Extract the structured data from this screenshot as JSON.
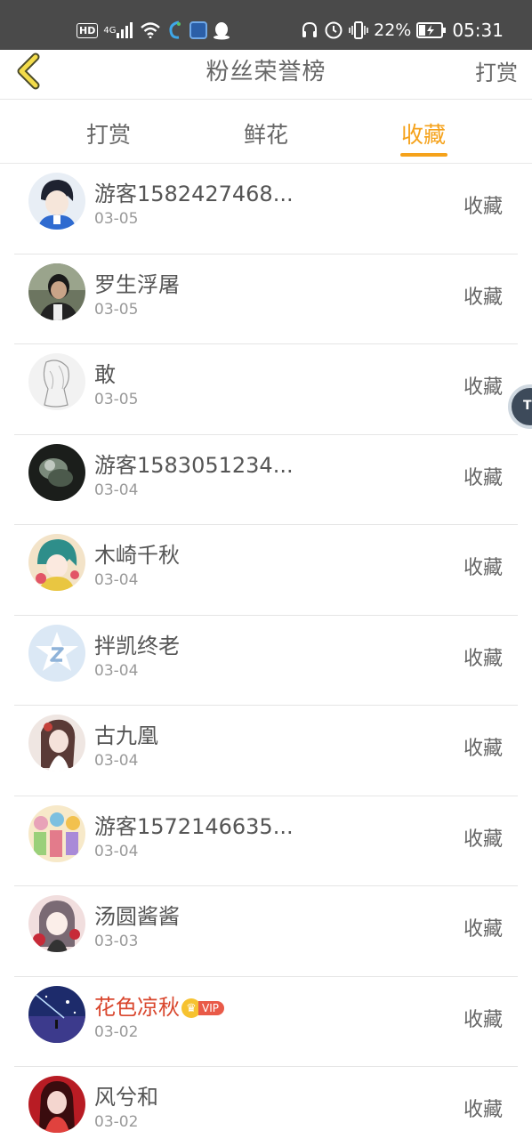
{
  "status_bar": {
    "left_icons": [
      "hd-icon",
      "4g-signal-icon",
      "wifi-icon",
      "phone-app-icon",
      "chat-app-icon",
      "qq-icon"
    ],
    "right_icons": [
      "headset-icon",
      "alarm-icon",
      "vibrate-icon",
      "battery-icon"
    ],
    "hd": "HD",
    "net": "4G",
    "battery": "22%",
    "time": "05:31"
  },
  "header": {
    "title": "粉丝荣誉榜",
    "action": "打赏",
    "back_icon": "chevron-left-icon"
  },
  "tabs": [
    {
      "label": "打赏",
      "active": false
    },
    {
      "label": "鲜花",
      "active": false
    },
    {
      "label": "收藏",
      "active": true
    }
  ],
  "colors": {
    "accent": "#f5a21b",
    "status_bar": "#4a4a4a",
    "vip_name": "#d9472e",
    "vip_badge": "#e95a48"
  },
  "fans": [
    {
      "name": "游客1582427468...",
      "date": "03-05",
      "action": "收藏",
      "vip": false
    },
    {
      "name": "罗生浮屠",
      "date": "03-05",
      "action": "收藏",
      "vip": false
    },
    {
      "name": "敢",
      "date": "03-05",
      "action": "收藏",
      "vip": false
    },
    {
      "name": "游客1583051234...",
      "date": "03-04",
      "action": "收藏",
      "vip": false
    },
    {
      "name": "木崎千秋",
      "date": "03-04",
      "action": "收藏",
      "vip": false
    },
    {
      "name": "拌凯终老",
      "date": "03-04",
      "action": "收藏",
      "vip": false
    },
    {
      "name": "古九凰",
      "date": "03-04",
      "action": "收藏",
      "vip": false
    },
    {
      "name": "游客1572146635...",
      "date": "03-04",
      "action": "收藏",
      "vip": false
    },
    {
      "name": "汤圆酱酱",
      "date": "03-03",
      "action": "收藏",
      "vip": false
    },
    {
      "name": "花色凉秋",
      "date": "03-02",
      "action": "收藏",
      "vip": true,
      "badge": "VIP"
    },
    {
      "name": "风兮和",
      "date": "03-02",
      "action": "收藏",
      "vip": false
    }
  ],
  "float_ball": {
    "icon": "assistive-touch-icon",
    "label": "T"
  }
}
